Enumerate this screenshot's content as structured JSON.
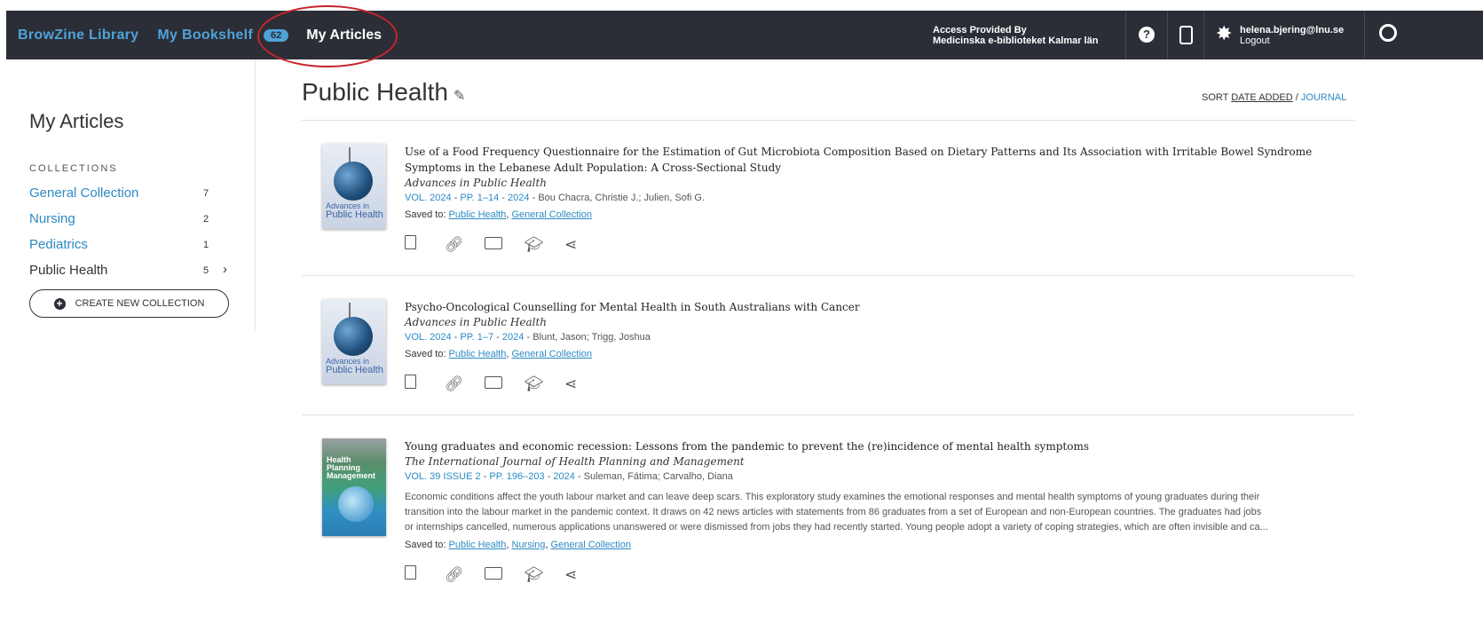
{
  "nav": {
    "library": "BrowZine Library",
    "bookshelf": "My Bookshelf",
    "bookshelf_count": "62",
    "articles": "My Articles",
    "access_line1": "Access Provided By",
    "access_line2": "Medicinska e-biblioteket Kalmar län",
    "help_symbol": "?",
    "user_email": "helena.bjering@lnu.se",
    "logout": "Logout"
  },
  "sidebar": {
    "title": "My Articles",
    "collections_label": "COLLECTIONS",
    "collections": [
      {
        "name": "General Collection",
        "count": "7"
      },
      {
        "name": "Nursing",
        "count": "2"
      },
      {
        "name": "Pediatrics",
        "count": "1"
      },
      {
        "name": "Public Health",
        "count": "5"
      }
    ],
    "create_button": "CREATE NEW COLLECTION"
  },
  "main": {
    "title": "Public Health",
    "sort_label": "SORT",
    "sort_date": "DATE ADDED",
    "sort_sep": "/",
    "sort_journal": "JOURNAL"
  },
  "articles": [
    {
      "title": "Use of a Food Frequency Questionnaire for the Estimation of Gut Microbiota Composition Based on Dietary Patterns and Its Association with Irritable Bowel Syndrome Symptoms in the Lebanese Adult Population: A Cross-Sectional Study",
      "journal": "Advances in Public Health",
      "vol": "VOL. 2024",
      "pages": "PP. 1–14",
      "year": "2024",
      "authors": "Bou Chacra, Christie J.; Julien, Sofi G.",
      "saved_label": "Saved to:",
      "saved": [
        "Public Health",
        "General Collection"
      ],
      "cover_text_1": "Advances in",
      "cover_text_2": "Public Health"
    },
    {
      "title": "Psycho-Oncological Counselling for Mental Health in South Australians with Cancer",
      "journal": "Advances in Public Health",
      "vol": "VOL. 2024",
      "pages": "PP. 1–7",
      "year": "2024",
      "authors": "Blunt, Jason; Trigg, Joshua",
      "saved_label": "Saved to:",
      "saved": [
        "Public Health",
        "General Collection"
      ],
      "cover_text_1": "Advances in",
      "cover_text_2": "Public Health"
    },
    {
      "title": "Young graduates and economic recession: Lessons from the pandemic to prevent the (re)incidence of mental health symptoms",
      "journal": "The International Journal of Health Planning and Management",
      "vol": "VOL. 39 ISSUE 2",
      "pages": "PP. 196–203",
      "year": "2024",
      "authors": "Suleman, Fátima; Carvalho, Diana",
      "abstract_1": "Economic conditions affect the youth labour market and can leave deep scars. This exploratory study examines the emotional responses and mental health symptoms of young graduates during their",
      "abstract_2": "transition into the labour market in the pandemic context. It draws on 42 news articles with statements from 86 graduates from a set of European and non-European countries. The graduates had jobs",
      "abstract_3": "or internships cancelled, numerous applications unanswered or were dismissed from jobs they had recently started. Young people adopt a variety of coping strategies, which are often invisible and ca...",
      "saved_label": "Saved to:",
      "saved": [
        "Public Health",
        "Nursing",
        "General Collection"
      ],
      "cover_text_1": "Health",
      "cover_text_2": "Planning",
      "cover_text_3": "Management"
    }
  ],
  "sep": "-",
  "comma": ",",
  "colors": {
    "topbar": "#2b2e36",
    "accent": "#4fa3d8",
    "link": "#2c8ac4",
    "highlight": "#c8242b"
  }
}
